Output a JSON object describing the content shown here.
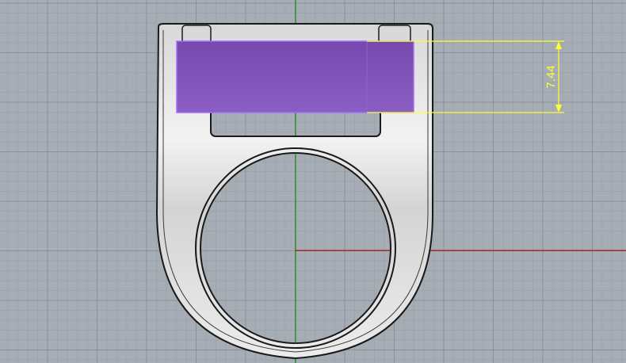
{
  "viewport": {
    "view": "Top",
    "background_color": "#a6adb4",
    "grid_minor_color": "#98a0a8",
    "grid_major_color": "#868e96"
  },
  "axes": {
    "x_axis_color": "#b01010",
    "y_axis_color": "#1a8a1a"
  },
  "object": {
    "type": "ring",
    "body_color": "#ececec",
    "outline_color": "#1a1a1a"
  },
  "selection": {
    "type": "box",
    "fill_color": "#7d52b8",
    "edge_color": "#9b5cff"
  },
  "dimension": {
    "value": "7.44",
    "color": "#ffff33"
  }
}
